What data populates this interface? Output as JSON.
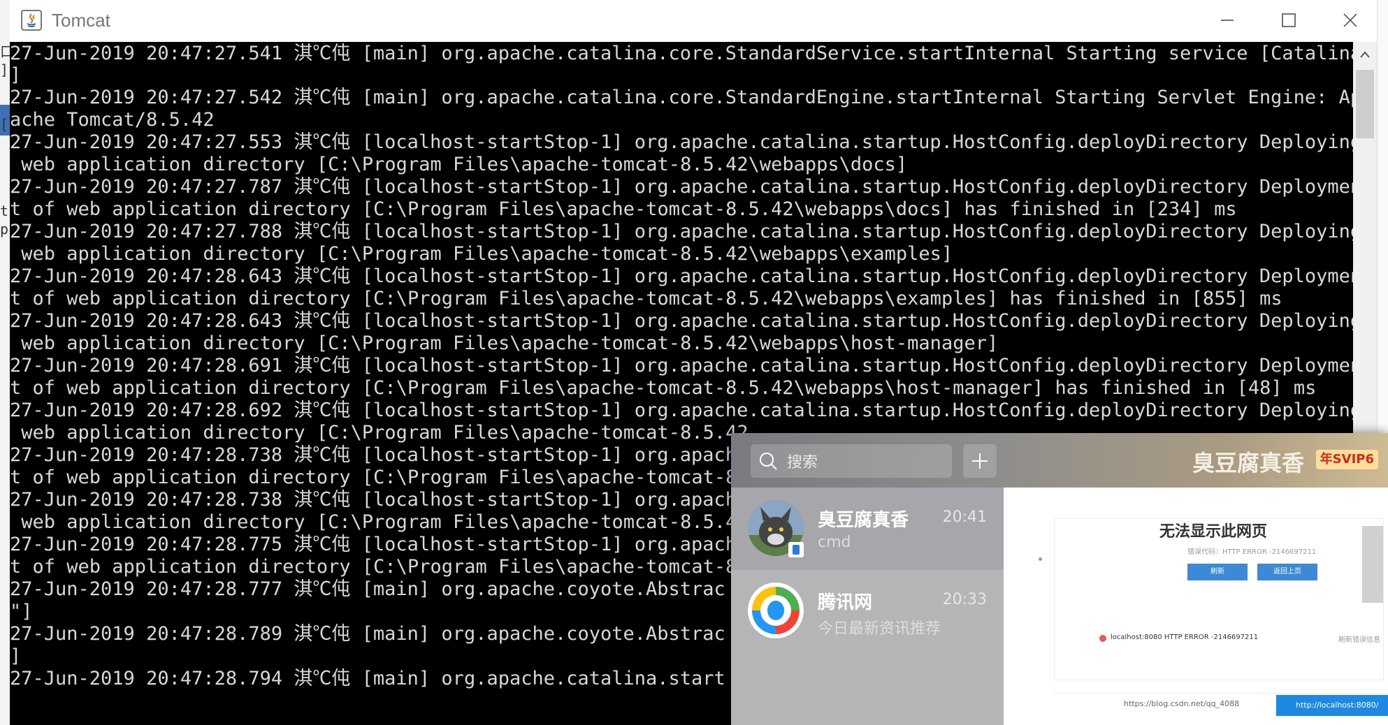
{
  "window": {
    "title": "Tomcat",
    "controls": [
      "minimize",
      "maximize",
      "close"
    ]
  },
  "console": {
    "lines": [
      "27-Jun-2019 20:47:27.541 淇℃伅 [main] org.apache.catalina.core.StandardService.startInternal Starting service [Catalina",
      "]",
      "27-Jun-2019 20:47:27.542 淇℃伅 [main] org.apache.catalina.core.StandardEngine.startInternal Starting Servlet Engine: Ap",
      "ache Tomcat/8.5.42",
      "27-Jun-2019 20:47:27.553 淇℃伅 [localhost-startStop-1] org.apache.catalina.startup.HostConfig.deployDirectory Deploying",
      " web application directory [C:\\Program Files\\apache-tomcat-8.5.42\\webapps\\docs]",
      "27-Jun-2019 20:47:27.787 淇℃伅 [localhost-startStop-1] org.apache.catalina.startup.HostConfig.deployDirectory Deploymen",
      "t of web application directory [C:\\Program Files\\apache-tomcat-8.5.42\\webapps\\docs] has finished in [234] ms",
      "27-Jun-2019 20:47:27.788 淇℃伅 [localhost-startStop-1] org.apache.catalina.startup.HostConfig.deployDirectory Deploying",
      " web application directory [C:\\Program Files\\apache-tomcat-8.5.42\\webapps\\examples]",
      "27-Jun-2019 20:47:28.643 淇℃伅 [localhost-startStop-1] org.apache.catalina.startup.HostConfig.deployDirectory Deploymen",
      "t of web application directory [C:\\Program Files\\apache-tomcat-8.5.42\\webapps\\examples] has finished in [855] ms",
      "27-Jun-2019 20:47:28.643 淇℃伅 [localhost-startStop-1] org.apache.catalina.startup.HostConfig.deployDirectory Deploying",
      " web application directory [C:\\Program Files\\apache-tomcat-8.5.42\\webapps\\host-manager]",
      "27-Jun-2019 20:47:28.691 淇℃伅 [localhost-startStop-1] org.apache.catalina.startup.HostConfig.deployDirectory Deploymen",
      "t of web application directory [C:\\Program Files\\apache-tomcat-8.5.42\\webapps\\host-manager] has finished in [48] ms",
      "27-Jun-2019 20:47:28.692 淇℃伅 [localhost-startStop-1] org.apache.catalina.startup.HostConfig.deployDirectory Deploying",
      " web application directory [C:\\Program Files\\apache-tomcat-8.5.42",
      "27-Jun-2019 20:47:28.738 淇℃伅 [localhost-startStop-1] org.apach",
      "t of web application directory [C:\\Program Files\\apache-tomcat-8.",
      "27-Jun-2019 20:47:28.738 淇℃伅 [localhost-startStop-1] org.apach",
      " web application directory [C:\\Program Files\\apache-tomcat-8.5.4",
      "27-Jun-2019 20:47:28.775 淇℃伅 [localhost-startStop-1] org.apach",
      "t of web application directory [C:\\Program Files\\apache-tomcat-8.",
      "27-Jun-2019 20:47:28.777 淇℃伅 [main] org.apache.coyote.Abstrac",
      "\"]",
      "27-Jun-2019 20:47:28.789 淇℃伅 [main] org.apache.coyote.Abstrac",
      "]",
      "27-Jun-2019 20:47:28.794 淇℃伅 [main] org.apache.catalina.start"
    ]
  },
  "desktop": {
    "left_marks": [
      "口",
      "]",
      "[",
      "t",
      "p"
    ]
  },
  "qq": {
    "search_placeholder": "搜索",
    "plus_label": "+",
    "user_name": "臭豆腐真香",
    "vip_badge": "年SVIP6",
    "chats": [
      {
        "name": "臭豆腐真香",
        "time": "20:41",
        "preview": "cmd"
      },
      {
        "name": "腾讯网",
        "time": "20:33",
        "preview": "今日最新资讯推荐"
      }
    ],
    "preview_page": {
      "title": "无法显示此网页",
      "subtitle": "错误代码：HTTP ERROR -2146697211",
      "button_1": "刷新",
      "button_2": "返回上页",
      "error_text": "localhost:8080 HTTP ERROR -2146697211",
      "right_note": "刷新错误信息",
      "tab_1": "https://blog.csdn.net/qq_4088",
      "tab_2": "http://localhost:8080/"
    }
  },
  "colors": {
    "console_bg": "#000000",
    "console_text": "#d8d8d8",
    "qq_accent": "#1e88e5"
  }
}
